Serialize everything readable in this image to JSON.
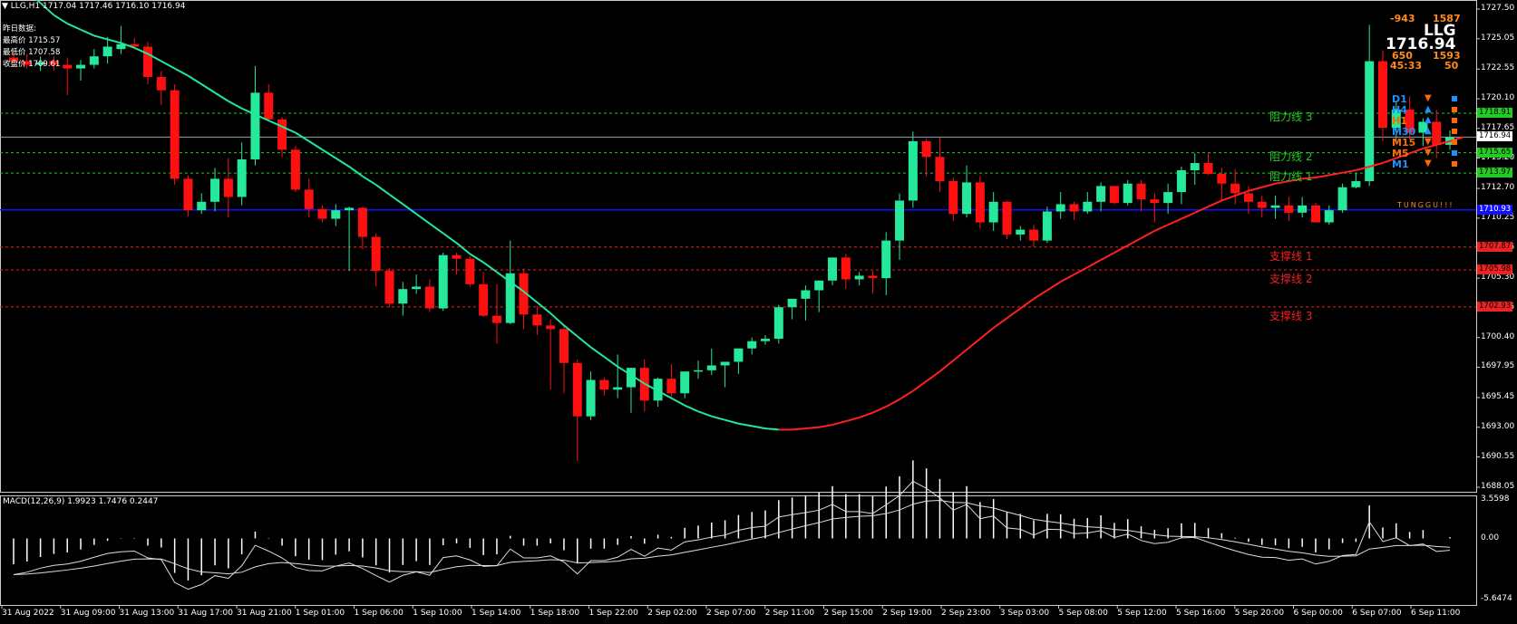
{
  "header": {
    "symbol_line": "LLG,H1  1717.04 1717.46 1716.10 1716.94",
    "menu_icon": "triangle-down-icon"
  },
  "prev_day": {
    "title": "昨日数据:",
    "high": "最高价 1715.57",
    "low": "最低价 1707.58",
    "close": "收盘价 1709.61"
  },
  "dashboard": {
    "symbol": "LLG",
    "price": "1716.94",
    "top_left": "-943",
    "top_right": "1587",
    "mid_left": "650",
    "mid_right": "1593",
    "bottom_left": "45:33",
    "bottom_right": "50",
    "timeframes": [
      {
        "label": "D1",
        "color": "#1e90ff",
        "arrow": "▼",
        "arrow_color": "#ff6a00",
        "sq_color": "#1e90ff"
      },
      {
        "label": "H4",
        "color": "#1e90ff",
        "arrow": "▲",
        "arrow_color": "#1e90ff",
        "sq_color": "#ff6a00"
      },
      {
        "label": "H1",
        "color": "#ff6a00",
        "arrow": "▲",
        "arrow_color": "#1e90ff",
        "sq_color": "#ff6a00"
      },
      {
        "label": "M30",
        "color": "#1e90ff",
        "arrow": "▲",
        "arrow_color": "#1e90ff",
        "sq_color": "#ff6a00"
      },
      {
        "label": "M15",
        "color": "#ff6a00",
        "arrow": "▼",
        "arrow_color": "#ff6a00",
        "sq_color": "#ff6a00"
      },
      {
        "label": "M5",
        "color": "#ff6a00",
        "arrow": "▼",
        "arrow_color": "#ff6a00",
        "sq_color": "#1e90ff"
      },
      {
        "label": "M1",
        "color": "#1e90ff",
        "arrow": "▼",
        "arrow_color": "#ff6a00",
        "sq_color": "#ff6a00"
      }
    ],
    "waiting": "TUNGGU!!!"
  },
  "levels": {
    "resistance": [
      {
        "label": "阻力线 3",
        "price": 1718.91,
        "tag": "1718.91"
      },
      {
        "label": "阻力线 2",
        "price": 1715.65,
        "tag": "1715.65"
      },
      {
        "label": "阻力线 1",
        "price": 1713.97,
        "tag": "1713.97"
      }
    ],
    "support": [
      {
        "label": "支撑线 1",
        "price": 1707.87,
        "tag": "1707.87"
      },
      {
        "label": "支撑线 2",
        "price": 1705.98,
        "tag": "1705.98"
      },
      {
        "label": "支撑线 3",
        "price": 1702.93,
        "tag": "1702.93"
      }
    ],
    "pivot": {
      "price": 1710.93,
      "tag": "1710.93"
    },
    "current": {
      "price": 1716.94,
      "tag": "1716.94"
    }
  },
  "colors": {
    "bull": "#26e89a",
    "bear": "#ff1010",
    "ma_up": "#ff2020",
    "ma_down": "#20e8a0",
    "resistance": "#22cc22",
    "support": "#ee2222",
    "pivot": "#1010ff",
    "grid_text": "#ffffff"
  },
  "chart_data": [
    {
      "type": "candlestick",
      "title": "LLG,H1",
      "y_ticks": [
        "1727.50",
        "1725.05",
        "1722.55",
        "1720.10",
        "1717.65",
        "1715.20",
        "1712.70",
        "1710.25",
        "1707.75",
        "1705.30",
        "1702.85",
        "1700.40",
        "1697.95",
        "1695.45",
        "1693.00",
        "1690.55",
        "1688.05"
      ],
      "ylim": [
        1688.05,
        1727.5
      ],
      "x_ticks": [
        "31 Aug 2022",
        "31 Aug 09:00",
        "31 Aug 13:00",
        "31 Aug 17:00",
        "31 Aug 21:00",
        "1 Sep 01:00",
        "1 Sep 06:00",
        "1 Sep 10:00",
        "1 Sep 14:00",
        "1 Sep 18:00",
        "1 Sep 22:00",
        "2 Sep 02:00",
        "2 Sep 07:00",
        "2 Sep 11:00",
        "2 Sep 15:00",
        "2 Sep 19:00",
        "2 Sep 23:00",
        "3 Sep 03:00",
        "5 Sep 08:00",
        "5 Sep 12:00",
        "5 Sep 16:00",
        "5 Sep 20:00",
        "6 Sep 00:00",
        "6 Sep 07:00",
        "6 Sep 11:00"
      ],
      "ohlc": [
        [
          1723.5,
          1724.2,
          1722.8,
          1723.2
        ],
        [
          1723.2,
          1723.8,
          1722.6,
          1722.9
        ],
        [
          1722.9,
          1723.6,
          1722.4,
          1723.1
        ],
        [
          1723.2,
          1723.6,
          1722.4,
          1722.9
        ],
        [
          1722.9,
          1723.5,
          1720.4,
          1722.6
        ],
        [
          1722.6,
          1723.3,
          1721.6,
          1722.9
        ],
        [
          1722.9,
          1724.2,
          1722.6,
          1723.6
        ],
        [
          1723.6,
          1725.2,
          1723.0,
          1724.4
        ],
        [
          1724.2,
          1726.1,
          1723.8,
          1724.6
        ],
        [
          1724.6,
          1725.1,
          1724.2,
          1724.4
        ],
        [
          1724.4,
          1724.8,
          1721.3,
          1721.9
        ],
        [
          1721.9,
          1722.4,
          1719.6,
          1720.8
        ],
        [
          1720.8,
          1721.3,
          1713.0,
          1713.5
        ],
        [
          1713.5,
          1713.8,
          1710.4,
          1710.9
        ],
        [
          1710.9,
          1712.3,
          1710.6,
          1711.6
        ],
        [
          1711.6,
          1714.4,
          1710.8,
          1713.5
        ],
        [
          1713.5,
          1715.2,
          1710.3,
          1712.0
        ],
        [
          1712.0,
          1716.5,
          1711.3,
          1715.1
        ],
        [
          1715.1,
          1722.8,
          1714.6,
          1720.6
        ],
        [
          1720.6,
          1721.3,
          1718.3,
          1718.4
        ],
        [
          1718.4,
          1718.6,
          1715.3,
          1715.9
        ],
        [
          1715.9,
          1716.2,
          1712.4,
          1712.6
        ],
        [
          1712.6,
          1713.5,
          1710.3,
          1711.0
        ],
        [
          1711.0,
          1711.3,
          1709.9,
          1710.2
        ],
        [
          1710.2,
          1711.4,
          1709.6,
          1710.9
        ],
        [
          1710.9,
          1711.2,
          1705.9,
          1711.1
        ],
        [
          1711.1,
          1711.2,
          1707.7,
          1708.7
        ],
        [
          1708.7,
          1709.0,
          1704.6,
          1705.9
        ],
        [
          1705.9,
          1706.1,
          1702.9,
          1703.2
        ],
        [
          1703.2,
          1705.0,
          1702.2,
          1704.4
        ],
        [
          1704.4,
          1705.6,
          1704.0,
          1704.6
        ],
        [
          1704.6,
          1705.2,
          1702.5,
          1702.8
        ],
        [
          1702.8,
          1707.4,
          1702.6,
          1707.2
        ],
        [
          1707.2,
          1707.4,
          1705.6,
          1706.9
        ],
        [
          1706.9,
          1707.1,
          1704.6,
          1704.8
        ],
        [
          1704.8,
          1705.8,
          1702.1,
          1702.2
        ],
        [
          1702.2,
          1704.8,
          1699.9,
          1701.6
        ],
        [
          1701.6,
          1708.4,
          1701.5,
          1705.7
        ],
        [
          1705.7,
          1706.1,
          1701.1,
          1702.3
        ],
        [
          1702.3,
          1703.0,
          1700.6,
          1701.4
        ],
        [
          1701.4,
          1701.9,
          1696.1,
          1701.1
        ],
        [
          1701.1,
          1701.5,
          1695.8,
          1698.3
        ],
        [
          1698.3,
          1698.6,
          1690.2,
          1693.9
        ],
        [
          1693.9,
          1697.6,
          1693.6,
          1696.9
        ],
        [
          1696.9,
          1697.1,
          1695.6,
          1696.1
        ],
        [
          1696.1,
          1699.0,
          1695.4,
          1696.3
        ],
        [
          1696.3,
          1697.4,
          1694.2,
          1697.9
        ],
        [
          1697.9,
          1698.6,
          1694.3,
          1695.2
        ],
        [
          1695.2,
          1697.1,
          1694.7,
          1697.0
        ],
        [
          1697.0,
          1698.2,
          1695.4,
          1695.8
        ],
        [
          1695.8,
          1697.6,
          1695.4,
          1697.6
        ],
        [
          1697.6,
          1698.5,
          1697.0,
          1697.7
        ],
        [
          1697.7,
          1699.5,
          1697.3,
          1698.1
        ],
        [
          1698.1,
          1698.4,
          1696.3,
          1698.4
        ],
        [
          1698.4,
          1699.1,
          1697.4,
          1699.5
        ],
        [
          1699.5,
          1700.4,
          1699.0,
          1700.1
        ],
        [
          1700.1,
          1700.6,
          1699.8,
          1700.3
        ],
        [
          1700.3,
          1703.1,
          1699.9,
          1702.9
        ],
        [
          1702.9,
          1703.5,
          1701.9,
          1703.6
        ],
        [
          1703.6,
          1704.7,
          1701.8,
          1704.3
        ],
        [
          1704.3,
          1705.1,
          1702.5,
          1705.1
        ],
        [
          1705.1,
          1707.0,
          1704.7,
          1707.0
        ],
        [
          1707.0,
          1707.3,
          1704.4,
          1705.2
        ],
        [
          1705.2,
          1705.8,
          1704.7,
          1705.5
        ],
        [
          1705.5,
          1705.9,
          1704.0,
          1705.3
        ],
        [
          1705.3,
          1709.1,
          1703.9,
          1708.4
        ],
        [
          1708.4,
          1712.3,
          1706.8,
          1711.7
        ],
        [
          1711.7,
          1717.4,
          1711.1,
          1716.6
        ],
        [
          1716.6,
          1716.8,
          1713.7,
          1715.3
        ],
        [
          1715.3,
          1716.9,
          1712.4,
          1713.3
        ],
        [
          1713.3,
          1713.6,
          1710.0,
          1710.6
        ],
        [
          1710.6,
          1714.6,
          1710.3,
          1713.2
        ],
        [
          1713.2,
          1713.7,
          1709.4,
          1709.9
        ],
        [
          1709.9,
          1712.4,
          1709.2,
          1711.6
        ],
        [
          1711.6,
          1711.7,
          1708.5,
          1708.9
        ],
        [
          1708.9,
          1709.6,
          1708.4,
          1709.3
        ],
        [
          1709.3,
          1709.7,
          1707.9,
          1708.4
        ],
        [
          1708.4,
          1711.2,
          1708.2,
          1710.8
        ],
        [
          1710.8,
          1712.4,
          1710.2,
          1711.4
        ],
        [
          1711.4,
          1711.6,
          1710.1,
          1710.8
        ],
        [
          1710.8,
          1712.4,
          1710.6,
          1711.6
        ],
        [
          1711.6,
          1713.2,
          1710.8,
          1712.9
        ],
        [
          1712.9,
          1712.7,
          1711.4,
          1711.5
        ],
        [
          1711.5,
          1713.4,
          1711.3,
          1713.1
        ],
        [
          1713.1,
          1713.4,
          1710.8,
          1711.8
        ],
        [
          1711.8,
          1712.3,
          1709.9,
          1711.5
        ],
        [
          1711.5,
          1713.1,
          1710.6,
          1712.4
        ],
        [
          1712.4,
          1714.5,
          1711.4,
          1714.2
        ],
        [
          1714.2,
          1715.6,
          1713.0,
          1714.8
        ],
        [
          1714.8,
          1715.7,
          1713.8,
          1713.9
        ],
        [
          1713.9,
          1714.4,
          1711.6,
          1713.1
        ],
        [
          1713.1,
          1714.3,
          1711.4,
          1712.3
        ],
        [
          1712.3,
          1712.9,
          1710.6,
          1711.6
        ],
        [
          1711.6,
          1712.1,
          1710.3,
          1711.1
        ],
        [
          1711.1,
          1712.1,
          1710.2,
          1711.3
        ],
        [
          1711.3,
          1712.0,
          1710.0,
          1710.7
        ],
        [
          1710.7,
          1712.0,
          1710.3,
          1711.3
        ],
        [
          1711.3,
          1711.5,
          1710.1,
          1709.9
        ],
        [
          1709.9,
          1711.3,
          1709.7,
          1710.9
        ],
        [
          1710.9,
          1713.1,
          1710.7,
          1712.8
        ],
        [
          1712.8,
          1714.0,
          1712.7,
          1713.3
        ],
        [
          1713.3,
          1726.2,
          1712.9,
          1723.2
        ],
        [
          1723.2,
          1724.1,
          1716.6,
          1717.7
        ],
        [
          1717.7,
          1719.8,
          1716.4,
          1719.2
        ],
        [
          1719.2,
          1720.3,
          1716.8,
          1717.3
        ],
        [
          1717.3,
          1718.5,
          1716.2,
          1718.2
        ],
        [
          1718.2,
          1719.2,
          1715.2,
          1716.3
        ],
        [
          1716.3,
          1717.5,
          1715.9,
          1716.94
        ]
      ],
      "ma": [
        1730.0,
        1729.0,
        1728.0,
        1727.0,
        1726.3,
        1725.8,
        1725.3,
        1725.0,
        1724.7,
        1724.3,
        1723.8,
        1723.2,
        1722.6,
        1722.0,
        1721.3,
        1720.6,
        1719.9,
        1719.3,
        1718.8,
        1718.3,
        1717.8,
        1717.3,
        1716.6,
        1715.9,
        1715.2,
        1714.5,
        1713.7,
        1713.0,
        1712.2,
        1711.4,
        1710.6,
        1709.8,
        1709.0,
        1708.2,
        1707.3,
        1706.6,
        1705.8,
        1705.0,
        1704.2,
        1703.3,
        1702.4,
        1701.4,
        1700.5,
        1699.6,
        1698.8,
        1698.0,
        1697.3,
        1696.6,
        1696.0,
        1695.4,
        1694.8,
        1694.3,
        1693.9,
        1693.6,
        1693.3,
        1693.1,
        1692.9,
        1692.8,
        1692.8,
        1692.9,
        1693.0,
        1693.2,
        1693.5,
        1693.8,
        1694.2,
        1694.7,
        1695.3,
        1696.0,
        1696.8,
        1697.6,
        1698.5,
        1699.4,
        1700.3,
        1701.2,
        1702.0,
        1702.8,
        1703.6,
        1704.3,
        1705.0,
        1705.6,
        1706.2,
        1706.8,
        1707.4,
        1708.0,
        1708.6,
        1709.2,
        1709.7,
        1710.2,
        1710.7,
        1711.2,
        1711.7,
        1712.1,
        1712.5,
        1712.8,
        1713.1,
        1713.3,
        1713.5,
        1713.6,
        1713.8,
        1714.0,
        1714.2,
        1714.5,
        1714.8,
        1715.2,
        1715.6,
        1716.0,
        1716.3,
        1716.6,
        1716.94
      ],
      "macd": {
        "label": "MACD(12,26,9) 1.9923 1.7476 0.2447",
        "y_ticks": [
          "3.5598",
          "0.00",
          "-5.6474"
        ],
        "ylim": [
          -5.6474,
          3.5598
        ]
      }
    }
  ]
}
